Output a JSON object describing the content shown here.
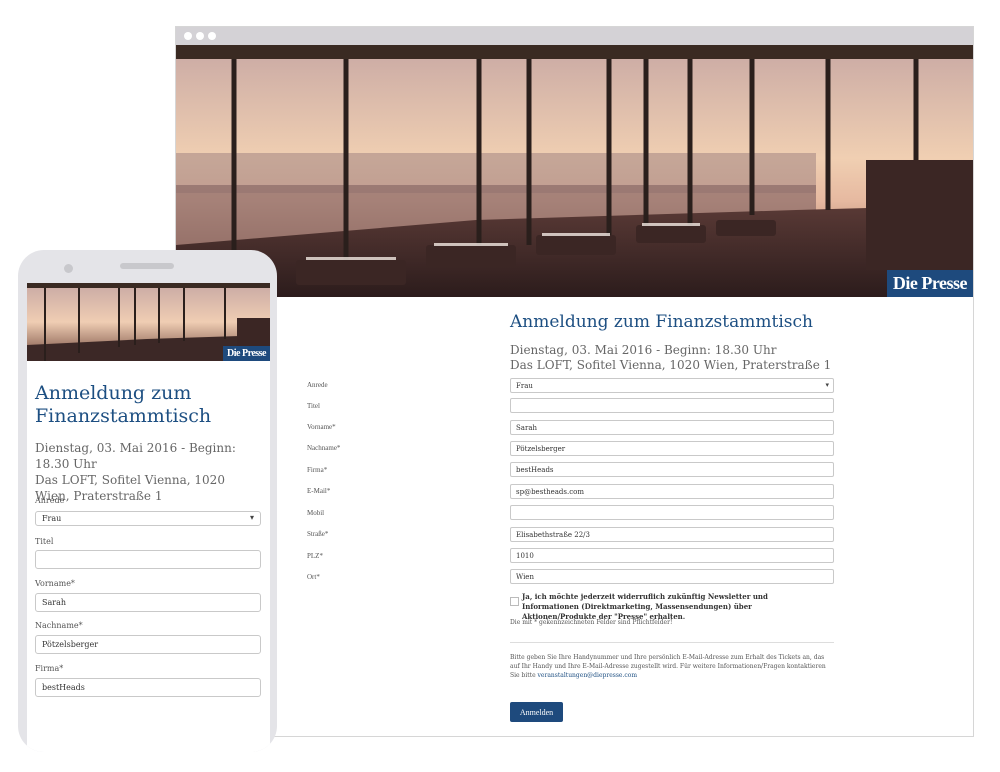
{
  "brand": "Die Presse",
  "colors": {
    "brand_blue": "#1e4a7d",
    "title_blue": "#1d4f82",
    "phone_frame": "#e4e4e8",
    "browser_bar": "#d4d2d6"
  },
  "form": {
    "title": "Anmeldung zum Finanzstammtisch",
    "mobile_title": "Anmeldung zum Finanzstammtisch",
    "date_line": "Dienstag, 03. Mai 2016 - Beginn: 18.30 Uhr",
    "venue_line": "Das LOFT, Sofitel Vienna, 1020 Wien, Praterstraße 1",
    "fields": [
      {
        "label": "Anrede",
        "value": "Frau"
      },
      {
        "label": "Titel",
        "value": ""
      },
      {
        "label": "Vorname*",
        "value": "Sarah"
      },
      {
        "label": "Nachname*",
        "value": "Pötzelsberger"
      },
      {
        "label": "Firma*",
        "value": "bestHeads"
      },
      {
        "label": "E-Mail*",
        "value": "sp@bestheads.com"
      },
      {
        "label": "Mobil",
        "value": ""
      },
      {
        "label": "Straße*",
        "value": "Elisabethstraße 22/3"
      },
      {
        "label": "PLZ*",
        "value": "1010"
      },
      {
        "label": "Ort*",
        "value": "Wien"
      }
    ],
    "newsletter_text": "Ja, ich möchte jederzeit widerruflich zukünftig Newsletter und Informationen (Direktmarketing, Massensendungen) über Aktionen/Produkte der \"Presse\" erhalten.",
    "required_note": "Die mit * gekennzeichneten Felder sind Pflichtfelder!",
    "info_text": "Bitte geben Sie Ihre Handynummer und Ihre persönlich E-Mail-Adresse zum Erhalt des Tickets an, das auf Ihr Handy und Ihre E-Mail-Adresse zugestellt wird. Für weitere Informationen/Fragen kontaktieren Sie bitte",
    "contact_email": "veranstaltungen@diepresse.com",
    "submit_label": "Anmelden"
  }
}
